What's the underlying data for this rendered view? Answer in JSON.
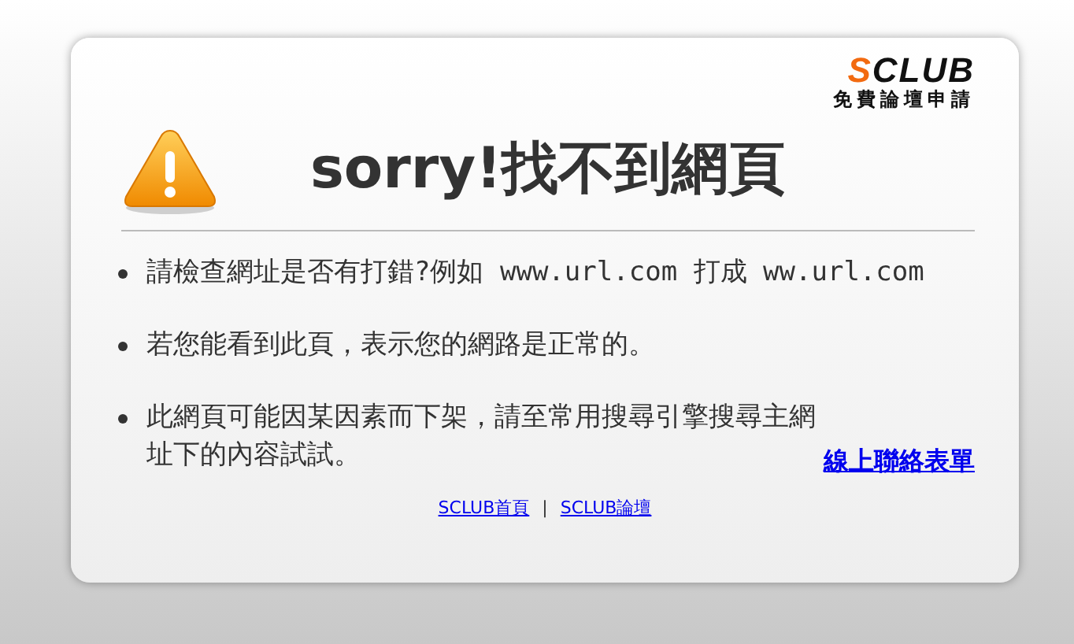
{
  "logo": {
    "mark": "S",
    "rest": "CLUB",
    "tagline": "免費論壇申請"
  },
  "title": "sorry!找不到網頁",
  "tips": [
    "請檢查網址是否有打錯?例如 www.url.com 打成 ww.url.com",
    "若您能看到此頁，表示您的網路是正常的。",
    "此網頁可能因某因素而下架，請至常用搜尋引擎搜尋主網址下的內容試試。"
  ],
  "contact_link": "線上聯絡表單",
  "footer_links": [
    "SCLUB首頁",
    "SCLUB論壇"
  ],
  "separator": "|"
}
